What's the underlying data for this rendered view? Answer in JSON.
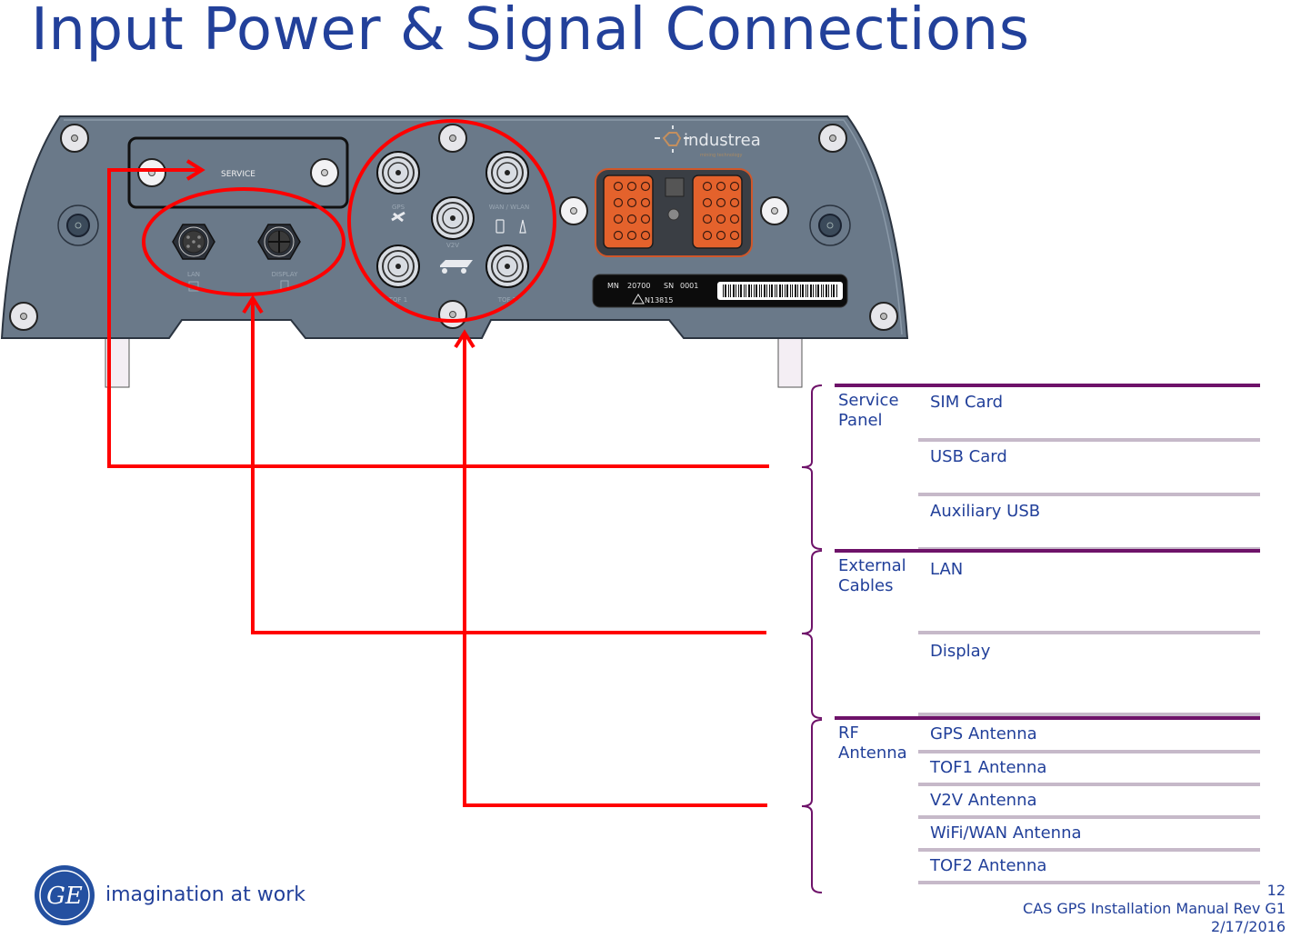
{
  "page": {
    "title": "Input Power & Signal Connections"
  },
  "device": {
    "brand": "industrea",
    "brand_tagline": "mining technology",
    "service_panel_label": "SERVICE",
    "ports": {
      "lan": "LAN",
      "display": "DISPLAY",
      "gps": "GPS",
      "wan_wlan": "WAN / WLAN",
      "v2v": "V2V",
      "tof1": "TOF 1",
      "tof2": "TOF 2"
    },
    "nameplate": {
      "mn_label": "MN",
      "mn_value": "20700",
      "sn_label": "SN",
      "sn_value": "0001",
      "cert": "N13815"
    },
    "colors": {
      "body": "#6a7989",
      "highlight": "#ff0000",
      "connector": "#e4622c"
    }
  },
  "table": {
    "groups": [
      {
        "label": "Service Panel",
        "items": [
          "SIM Card",
          "USB Card",
          "Auxiliary USB"
        ]
      },
      {
        "label": "External Cables",
        "items": [
          "LAN",
          "Display"
        ]
      },
      {
        "label": "RF Antenna",
        "items": [
          "GPS Antenna",
          "TOF1 Antenna",
          "V2V Antenna",
          "WiFi/WAN Antenna",
          "TOF2 Antenna"
        ]
      }
    ],
    "colors": {
      "group_rule": "#6e1269",
      "item_rule": "#c6b9c9",
      "text": "#22409a"
    }
  },
  "footer": {
    "logo": "GE",
    "tagline": "imagination at work",
    "page_number": "12",
    "document": "CAS GPS Installation Manual Rev G1",
    "date": "2/17/2016"
  }
}
